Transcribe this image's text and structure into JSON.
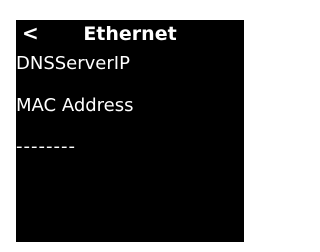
{
  "header": {
    "back_label": "<",
    "title": "Ethernet"
  },
  "rows": [
    {
      "label": "DNSServerIP"
    },
    {
      "label": "MAC Address"
    },
    {
      "label": "--------"
    }
  ]
}
